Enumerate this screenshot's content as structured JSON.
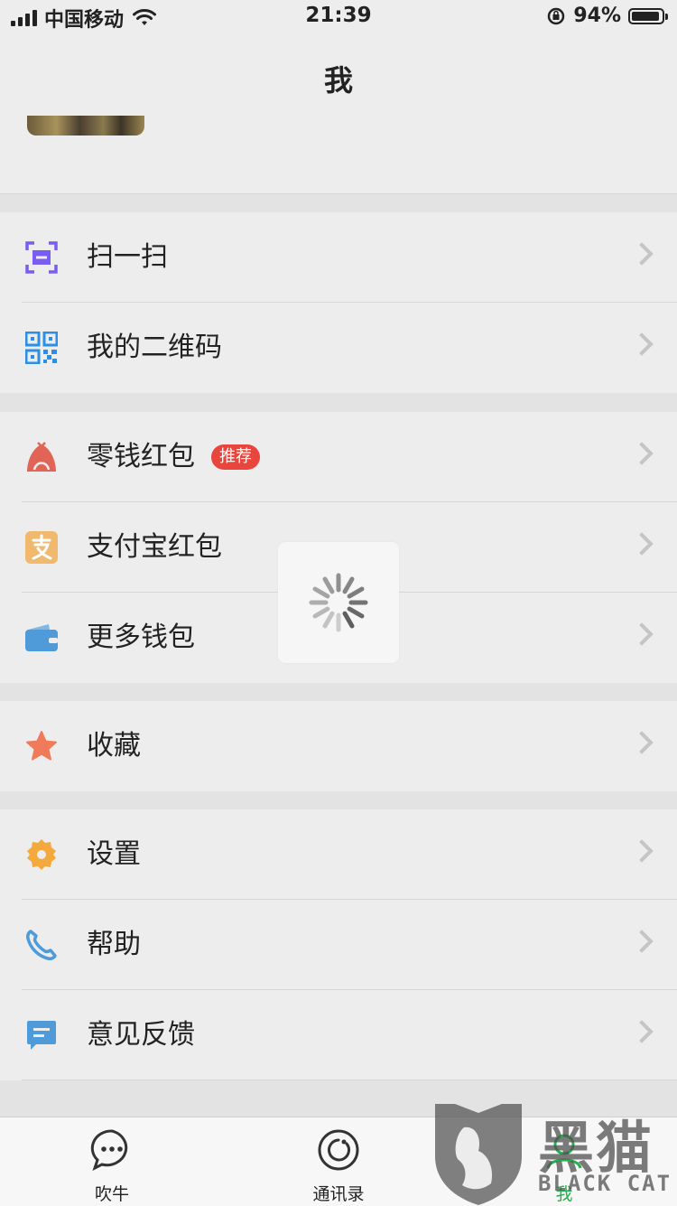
{
  "status_bar": {
    "carrier": "中国移动",
    "time": "21:39",
    "battery_percent": "94%",
    "battery_level": 0.94
  },
  "header": {
    "title": "我"
  },
  "menu": {
    "group1": [
      {
        "label": "扫一扫",
        "icon": "scan-icon",
        "color": "#7a5cf0"
      },
      {
        "label": "我的二维码",
        "icon": "qrcode-icon",
        "color": "#2b8ee8"
      }
    ],
    "group2": [
      {
        "label": "零钱红包",
        "icon": "red-packet-icon",
        "color": "#e06556",
        "badge": "推荐"
      },
      {
        "label": "支付宝红包",
        "icon": "alipay-icon",
        "color": "#f0b96e"
      },
      {
        "label": "更多钱包",
        "icon": "wallet-icon",
        "color": "#4f9ad8"
      }
    ],
    "group3": [
      {
        "label": "收藏",
        "icon": "star-icon",
        "color": "#f07b5a"
      }
    ],
    "group4": [
      {
        "label": "设置",
        "icon": "gear-icon",
        "color": "#f3a93c"
      },
      {
        "label": "帮助",
        "icon": "phone-icon",
        "color": "#4f9ad8"
      },
      {
        "label": "意见反馈",
        "icon": "feedback-icon",
        "color": "#4f9ad8"
      }
    ]
  },
  "tabbar": {
    "tabs": [
      {
        "label": "吹牛",
        "icon": "chat-bubble-icon"
      },
      {
        "label": "通讯录",
        "icon": "contacts-icon"
      },
      {
        "label": "我",
        "icon": "me-icon"
      }
    ]
  },
  "watermark": {
    "text": "黑猫",
    "sub": "BLACK CAT"
  }
}
